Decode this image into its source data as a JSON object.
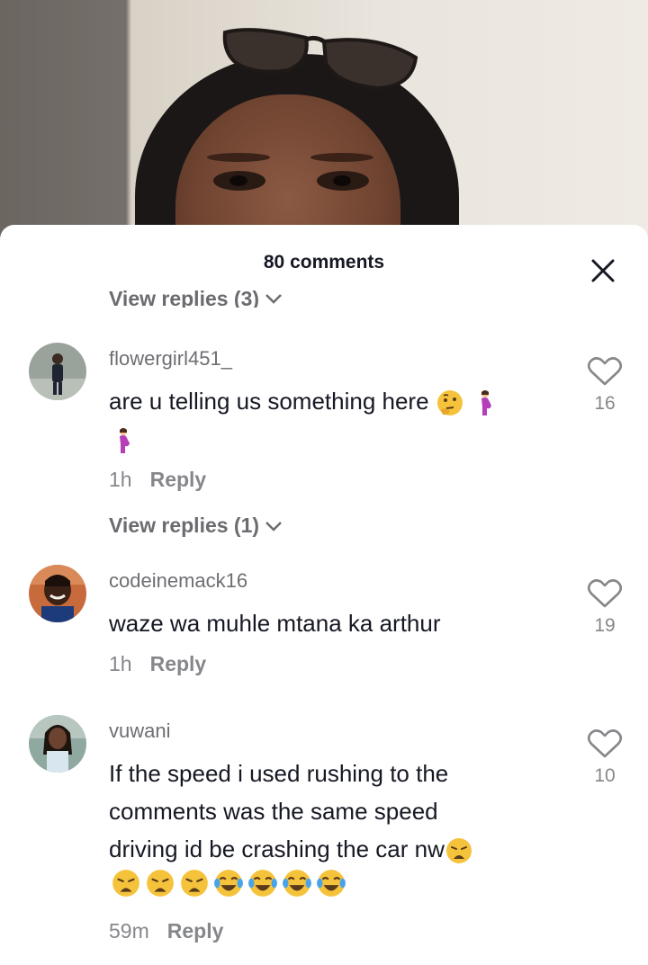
{
  "sheet": {
    "title": "80 comments"
  },
  "replies_top": "View replies (3)",
  "comments": [
    {
      "username": "flowergirl451_",
      "text": "are u telling us something here",
      "time": "1h",
      "reply_label": "Reply",
      "likes": "16",
      "replies_label": "View replies (1)"
    },
    {
      "username": "codeinemack16",
      "text": "waze wa muhle mtana ka arthur",
      "time": "1h",
      "reply_label": "Reply",
      "likes": "19"
    },
    {
      "username": "vuwani",
      "text_lines": [
        "If the speed i used rushing to the",
        "comments was the same speed",
        "driving id be crashing the car nw"
      ],
      "time": "59m",
      "reply_label": "Reply",
      "likes": "10"
    }
  ],
  "icons": {
    "close": "close-icon",
    "heart": "heart-outline-icon",
    "chevron": "chevron-down-icon"
  },
  "colors": {
    "text": "#161823",
    "muted": "#86878b",
    "sheet_bg": "#ffffff"
  }
}
